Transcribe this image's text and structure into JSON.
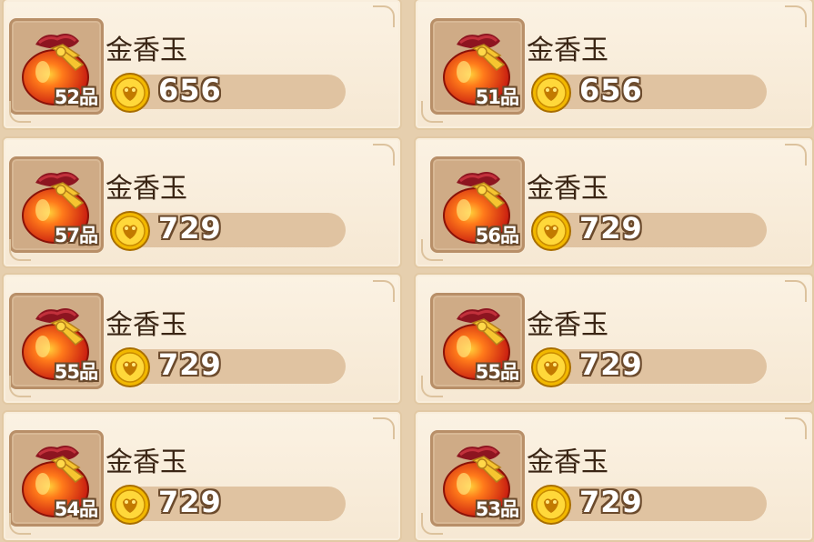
{
  "colors": {
    "background": "#e6cfae",
    "card": "#f8eddb",
    "price_bar": "#e0c3a1",
    "text_dark": "#3a2514",
    "outline": "#6b4a2c"
  },
  "items": [
    {
      "name": "金香玉",
      "grade": "52品",
      "price": "656",
      "icon": "red-lucky-bag-icon",
      "currency_icon": "gold-coin-icon"
    },
    {
      "name": "金香玉",
      "grade": "51品",
      "price": "656",
      "icon": "red-lucky-bag-icon",
      "currency_icon": "gold-coin-icon"
    },
    {
      "name": "金香玉",
      "grade": "57品",
      "price": "729",
      "icon": "red-lucky-bag-icon",
      "currency_icon": "gold-coin-icon"
    },
    {
      "name": "金香玉",
      "grade": "56品",
      "price": "729",
      "icon": "red-lucky-bag-icon",
      "currency_icon": "gold-coin-icon"
    },
    {
      "name": "金香玉",
      "grade": "55品",
      "price": "729",
      "icon": "red-lucky-bag-icon",
      "currency_icon": "gold-coin-icon"
    },
    {
      "name": "金香玉",
      "grade": "55品",
      "price": "729",
      "icon": "red-lucky-bag-icon",
      "currency_icon": "gold-coin-icon"
    },
    {
      "name": "金香玉",
      "grade": "54品",
      "price": "729",
      "icon": "red-lucky-bag-icon",
      "currency_icon": "gold-coin-icon"
    },
    {
      "name": "金香玉",
      "grade": "53品",
      "price": "729",
      "icon": "red-lucky-bag-icon",
      "currency_icon": "gold-coin-icon"
    }
  ]
}
